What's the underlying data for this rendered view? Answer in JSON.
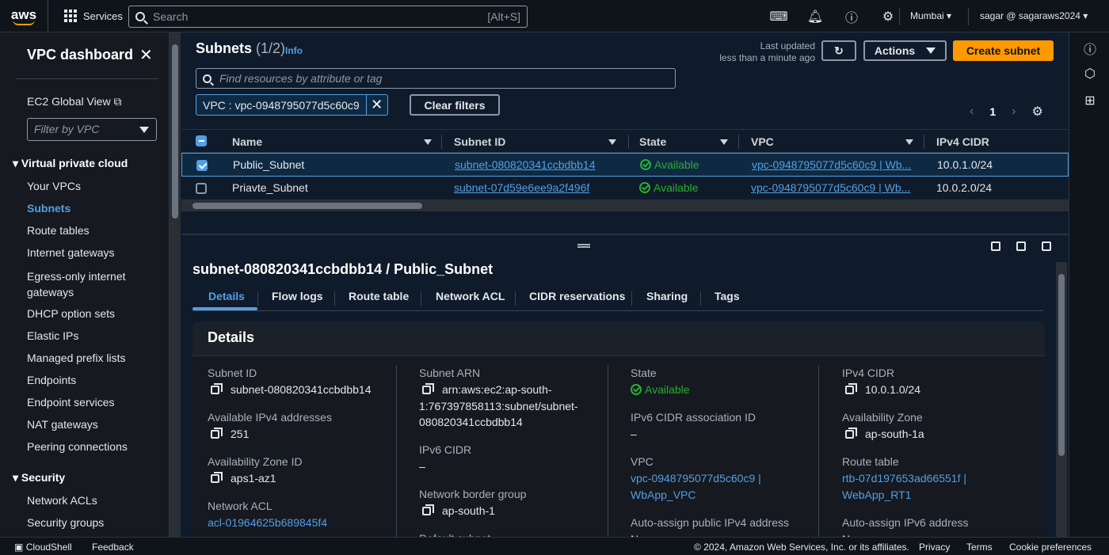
{
  "topbar": {
    "logo": "aws",
    "services": "Services",
    "search_placeholder": "Search",
    "search_hint": "[Alt+S]",
    "region": "Mumbai",
    "user": "sagar @ sagaraws2024"
  },
  "sidebar": {
    "title": "VPC dashboard",
    "global_view": "EC2 Global View",
    "filter_placeholder": "Filter by VPC",
    "section_vpc": "Virtual private cloud",
    "items": [
      "Your VPCs",
      "Subnets",
      "Route tables",
      "Internet gateways",
      "Egress-only internet gateways",
      "DHCP option sets",
      "Elastic IPs",
      "Managed prefix lists",
      "Endpoints",
      "Endpoint services",
      "NAT gateways",
      "Peering connections"
    ],
    "section_security": "Security",
    "security_items": [
      "Network ACLs",
      "Security groups"
    ]
  },
  "header": {
    "title": "Subnets",
    "count": "(1/2)",
    "info": "Info",
    "last_updated_1": "Last updated",
    "last_updated_2": "less than a minute ago",
    "actions": "Actions",
    "create": "Create subnet",
    "find_placeholder": "Find resources by attribute or tag",
    "token": "VPC : vpc-0948795077d5c60c9",
    "clear": "Clear filters",
    "page": "1"
  },
  "table": {
    "headers": [
      "Name",
      "Subnet ID",
      "State",
      "VPC",
      "IPv4 CIDR"
    ],
    "rows": [
      {
        "name": "Public_Subnet",
        "id": "subnet-080820341ccbdbb14",
        "state": "Available",
        "vpc": "vpc-0948795077d5c60c9 | Wb...",
        "cidr": "10.0.1.0/24",
        "selected": true
      },
      {
        "name": "Priavte_Subnet",
        "id": "subnet-07d59e6ee9a2f496f",
        "state": "Available",
        "vpc": "vpc-0948795077d5c60c9 | Wb...",
        "cidr": "10.0.2.0/24",
        "selected": false
      }
    ]
  },
  "detail": {
    "title": "subnet-080820341ccbdbb14 / Public_Subnet",
    "tabs": [
      "Details",
      "Flow logs",
      "Route table",
      "Network ACL",
      "CIDR reservations",
      "Sharing",
      "Tags"
    ],
    "card_title": "Details",
    "c1": {
      "subnet_id_label": "Subnet ID",
      "subnet_id": "subnet-080820341ccbdbb14",
      "avail_ipv4_label": "Available IPv4 addresses",
      "avail_ipv4": "251",
      "az_id_label": "Availability Zone ID",
      "az_id": "aps1-az1",
      "nacl_label": "Network ACL",
      "nacl": "acl-01964625b689845f4"
    },
    "c2": {
      "arn_label": "Subnet ARN",
      "arn_1": "arn:aws:ec2:ap-south-",
      "arn_2": "1:767397858113:subnet/subnet-",
      "arn_3": "080820341ccbdbb14",
      "ipv6_label": "IPv6 CIDR",
      "ipv6": "–",
      "nbg_label": "Network border group",
      "nbg": "ap-south-1",
      "default_label": "Default subnet"
    },
    "c3": {
      "state_label": "State",
      "state": "Available",
      "ipv6_assoc_label": "IPv6 CIDR association ID",
      "ipv6_assoc": "–",
      "vpc_label": "VPC",
      "vpc_1": "vpc-0948795077d5c60c9 |",
      "vpc_2": "WbApp_VPC",
      "auto_ipv4_label": "Auto-assign public IPv4 address",
      "auto_ipv4": "No"
    },
    "c4": {
      "cidr_label": "IPv4 CIDR",
      "cidr": "10.0.1.0/24",
      "az_label": "Availability Zone",
      "az": "ap-south-1a",
      "rt_label": "Route table",
      "rt_1": "rtb-07d197653ad66551f |",
      "rt_2": "WebApp_RT1",
      "auto_ipv6_label": "Auto-assign IPv6 address",
      "auto_ipv6": "No"
    }
  },
  "footer": {
    "cloudshell": "CloudShell",
    "feedback": "Feedback",
    "copyright": "© 2024, Amazon Web Services, Inc. or its affiliates.",
    "privacy": "Privacy",
    "terms": "Terms",
    "cookies": "Cookie preferences"
  }
}
